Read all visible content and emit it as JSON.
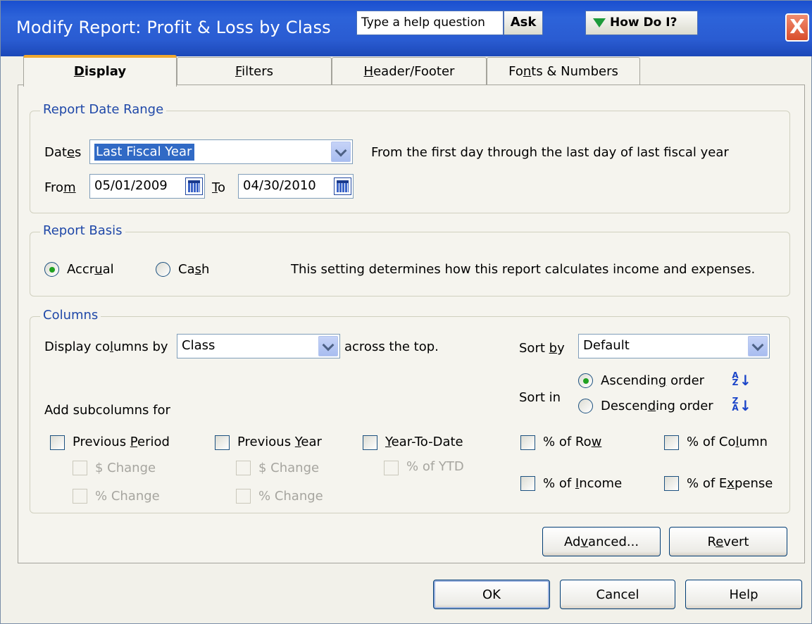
{
  "window": {
    "title": "Modify Report: Profit & Loss by Class",
    "help_placeholder": "Type a help question",
    "ask_label": "Ask",
    "how_do_i_label": "How Do I?",
    "close_glyph": "X"
  },
  "tabs": [
    {
      "label_pre": "",
      "label_u": "D",
      "label_post": "isplay",
      "active": true
    },
    {
      "label_pre": "",
      "label_u": "F",
      "label_post": "ilters",
      "active": false
    },
    {
      "label_pre": "",
      "label_u": "H",
      "label_post": "eader/Footer",
      "active": false
    },
    {
      "label_pre": "Fo",
      "label_u": "n",
      "label_post": "ts & Numbers",
      "active": false
    }
  ],
  "date_range": {
    "legend": "Report Date Range",
    "dates_label_pre": "Dat",
    "dates_label_u": "e",
    "dates_label_post": "s",
    "dates_value": "Last Fiscal Year",
    "dates_description": "From the first day through the last day of last fiscal year",
    "from_label_pre": "Fro",
    "from_label_u": "m",
    "from_value": "05/01/2009",
    "to_label_u": "T",
    "to_label_post": "o",
    "to_value": "04/30/2010"
  },
  "basis": {
    "legend": "Report Basis",
    "accrual_pre": "Accr",
    "accrual_u": "u",
    "accrual_post": "al",
    "cash_pre": "Ca",
    "cash_u": "s",
    "cash_post": "h",
    "selected": "accrual",
    "description": "This setting determines how this report calculates income and expenses."
  },
  "columns": {
    "legend": "Columns",
    "display_by_pre": "Display co",
    "display_by_u": "l",
    "display_by_post": "umns by",
    "display_by_value": "Class",
    "across_the_top": "across the top.",
    "sort_by_pre": "Sort ",
    "sort_by_u": "b",
    "sort_by_post": "y",
    "sort_by_value": "Default",
    "sort_in_label": "Sort in",
    "ascending_pre": "Ascendin",
    "ascending_u": "g",
    "ascending_post": " order",
    "descending_pre": "Descen",
    "descending_u": "d",
    "descending_post": "ing order",
    "sort_selected": "ascending",
    "asc_icon_glyph": "A Z",
    "desc_icon_glyph": "Z A",
    "add_subcolumns": "Add subcolumns for",
    "prev_period_pre": "Previous ",
    "prev_period_u": "P",
    "prev_period_post": "eriod",
    "prev_year_pre": "Previous ",
    "prev_year_u": "Y",
    "prev_year_post": "ear",
    "ytd_pre": "",
    "ytd_u": "Y",
    "ytd_post": "ear-To-Date",
    "dollar_change": "$ Change",
    "pct_change": "% Change",
    "pct_ytd": "% of YTD",
    "pct_row_pre": "% of Ro",
    "pct_row_u": "w",
    "pct_column_pre": "% of Co",
    "pct_column_u": "l",
    "pct_column_post": "umn",
    "pct_income_pre": "% of ",
    "pct_income_u": "I",
    "pct_income_post": "ncome",
    "pct_expense_pre": "% of E",
    "pct_expense_u": "x",
    "pct_expense_post": "pense"
  },
  "buttons": {
    "advanced_pre": "Ad",
    "advanced_u": "v",
    "advanced_post": "anced...",
    "revert_pre": "R",
    "revert_u": "e",
    "revert_post": "vert",
    "ok": "OK",
    "cancel": "Cancel",
    "help": "Help"
  }
}
